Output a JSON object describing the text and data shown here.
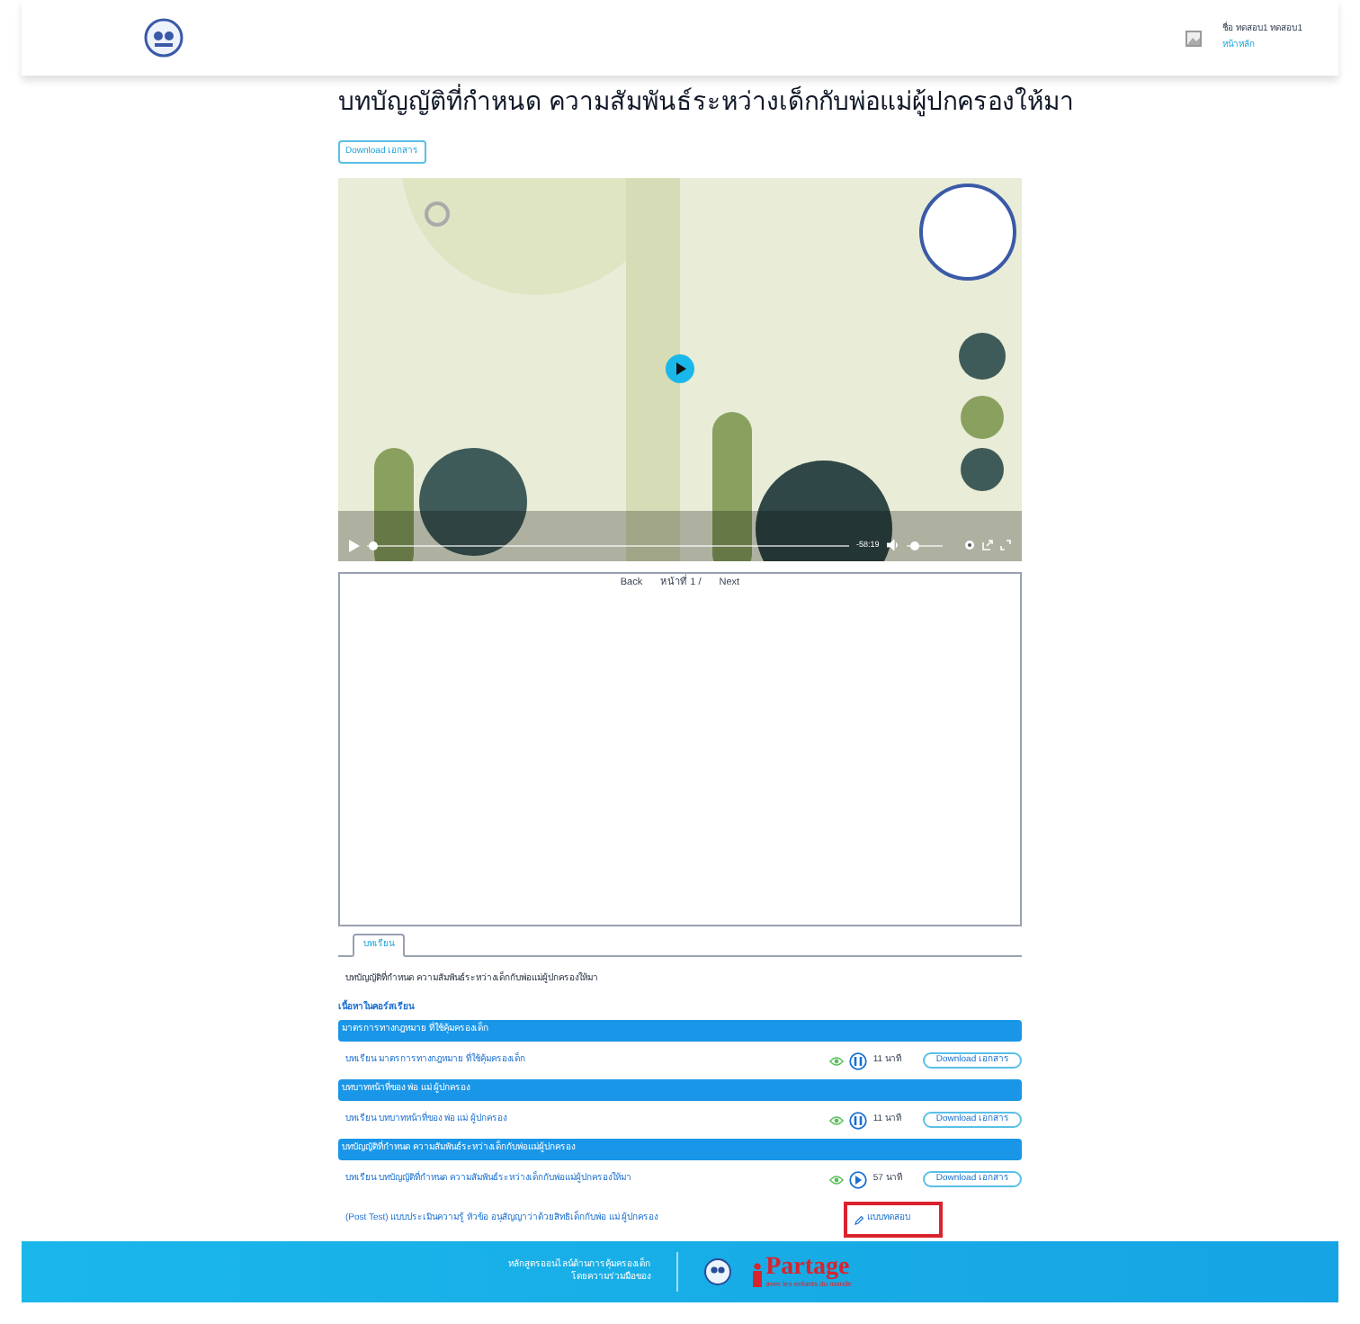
{
  "header": {
    "user_name": "ชื่อ ทดสอบ1 ทดสอบ1",
    "user_link": "หน้าหลัก"
  },
  "title": "บทบัญญัติที่กำหนด ความสัมพันธ์ระหว่างเด็กกับพ่อแม่ผู้ปกครองให้มา",
  "download_button": "Download เอกสาร",
  "video": {
    "kind": "picture",
    "time": "-58:19"
  },
  "pager": {
    "back": "Back",
    "page": "หน้าที่ 1 /",
    "next": "Next"
  },
  "tabs": [
    {
      "label": "บทเรียน",
      "selected": true
    }
  ],
  "description": "บทบัญญัติที่กำหนด ความสัมพันธ์ระหว่างเด็กกับพ่อแม่ผู้ปกครองให้มา",
  "course_heading": "เนื้อหาในคอร์สเรียน",
  "sections": [
    {
      "title": "มาตรการทางกฎหมาย ที่ใช้คุ้มครองเด็ก",
      "items": [
        {
          "kind": "lesson",
          "title": "บทเรียน มาตรการทางกฎหมาย ที่ใช้คุ้มครองเด็ก",
          "playing": true,
          "duration": "11 นาที",
          "button": "Download เอกสาร"
        }
      ]
    },
    {
      "title": "บทบาทหน้าที่ของ พ่อ แม่ ผู้ปกครอง",
      "items": [
        {
          "kind": "lesson",
          "title": "บทเรียน บทบาทหน้าที่ของ พ่อ แม่ ผู้ปกครอง",
          "playing": true,
          "duration": "11 นาที",
          "button": "Download เอกสาร"
        }
      ]
    },
    {
      "title": "บทบัญญัติที่กำหนด ความสัมพันธ์ระหว่างเด็กกับพ่อแม่ผู้ปกครอง",
      "items": [
        {
          "kind": "lesson",
          "title": "บทเรียน บทบัญญัติที่กำหนด ความสัมพันธ์ระหว่างเด็กกับพ่อแม่ผู้ปกครองให้มา",
          "playing": false,
          "duration": "57 นาที",
          "button": "Download เอกสาร"
        },
        {
          "kind": "test",
          "title": "(Post Test) แบบประเมินความรู้ หัวข้อ อนุสัญญาว่าด้วยสิทธิเด็กกับพ่อ แม่ ผู้ปกครอง",
          "button": "แบบทดสอบ",
          "highlighted": true
        }
      ]
    }
  ],
  "footer": {
    "line1": "หลักสูตรออนไลน์ด้านการคุ้มครองเด็ก",
    "line2": "โดยความร่วมมือของ",
    "brand": "Partage",
    "brand_tagline": "avec les enfants du monde"
  }
}
